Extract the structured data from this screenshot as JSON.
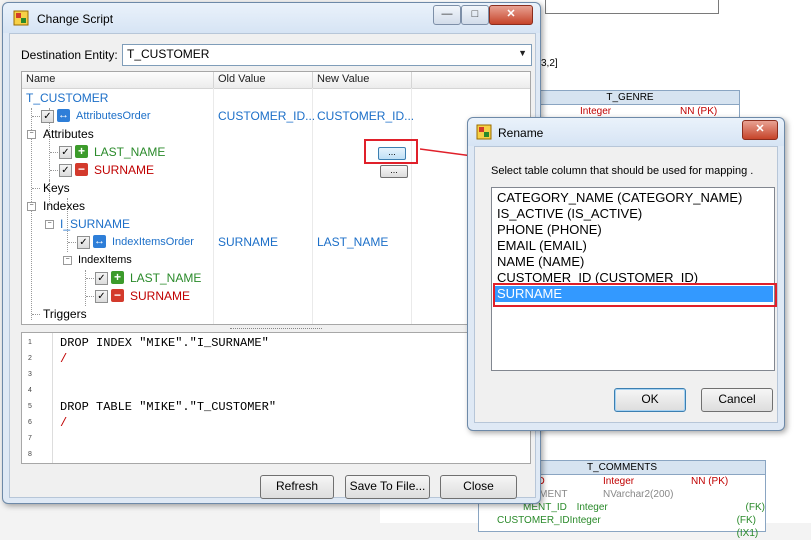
{
  "background": {
    "note_text": "3,2]",
    "entities": [
      {
        "name": "T_GENRE",
        "rows": [
          {
            "col": "D",
            "type": "Integer",
            "flags": "NN  (PK)",
            "style": "red"
          }
        ]
      },
      {
        "name": "T_COMMENTS",
        "rows": [
          {
            "col": "T_ID",
            "type": "Integer",
            "flags": "NN  (PK)",
            "style": "red"
          },
          {
            "col": "OMMENT",
            "type": "NVarchar2(200)",
            "flags": "",
            "style": "grey"
          },
          {
            "col": "MENT_ID",
            "type": "Integer",
            "flags": "(FK)",
            "style": "green"
          },
          {
            "col": "CUSTOMER_ID",
            "type": "Integer",
            "flags": "(FK)   (IX1)",
            "style": "green"
          }
        ]
      }
    ]
  },
  "change_script": {
    "title": "Change Script",
    "destination_label": "Destination Entity:",
    "destination_value": "T_CUSTOMER",
    "columns": {
      "name": "Name",
      "old": "Old Value",
      "new": "New Value"
    },
    "tree": {
      "root": "T_CUSTOMER",
      "attributes_order": {
        "label": "AttributesOrder",
        "old": "CUSTOMER_ID...",
        "new": "CUSTOMER_ID..."
      },
      "attributes_label": "Attributes",
      "last_name": "LAST_NAME",
      "surname": "SURNAME",
      "dots": "...",
      "keys": "Keys",
      "indexes": "Indexes",
      "i_surname": "I_SURNAME",
      "index_items_order": {
        "label": "IndexItemsOrder",
        "old": "SURNAME",
        "new": "LAST_NAME"
      },
      "index_items": "IndexItems",
      "ii_last_name": "LAST_NAME",
      "ii_surname": "SURNAME",
      "triggers": "Triggers"
    },
    "code_lines": [
      {
        "n": "1",
        "text": "DROP INDEX \"MIKE\".\"I_SURNAME\""
      },
      {
        "n": "2",
        "text": "/"
      },
      {
        "n": "3",
        "text": ""
      },
      {
        "n": "4",
        "text": ""
      },
      {
        "n": "5",
        "text": "DROP TABLE \"MIKE\".\"T_CUSTOMER\""
      },
      {
        "n": "6",
        "text": "/"
      },
      {
        "n": "7",
        "text": ""
      },
      {
        "n": "8",
        "text": ""
      }
    ],
    "buttons": {
      "refresh": "Refresh",
      "save": "Save To File...",
      "close": "Close"
    }
  },
  "rename": {
    "title": "Rename",
    "instruction": "Select table column that should be used for mapping .",
    "items": [
      "CATEGORY_NAME (CATEGORY_NAME)",
      "IS_ACTIVE (IS_ACTIVE)",
      "PHONE (PHONE)",
      "EMAIL (EMAIL)",
      "NAME (NAME)",
      "CUSTOMER_ID (CUSTOMER_ID)",
      "SURNAME"
    ],
    "selected_index": 6,
    "ok": "OK",
    "cancel": "Cancel"
  },
  "colors": {
    "highlight": "#e0202a",
    "selection": "#3399ff",
    "accent_blue": "#1c6fc8"
  }
}
